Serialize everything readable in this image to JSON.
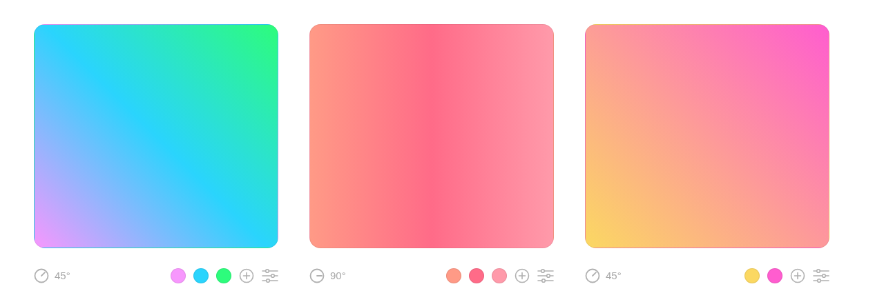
{
  "gradients": [
    {
      "angle": "45°",
      "colors": [
        {
          "color": "#f797fd"
        },
        {
          "color": "#2ad4fd"
        },
        {
          "color": "#2dfc7c"
        }
      ]
    },
    {
      "angle": "90°",
      "colors": [
        {
          "color": "#ff9a86"
        },
        {
          "color": "#ff6b88"
        },
        {
          "color": "#ff9aaa"
        }
      ]
    },
    {
      "angle": "45°",
      "colors": [
        {
          "color": "#fbd862"
        },
        {
          "color": "#ff5dcf"
        }
      ]
    }
  ]
}
